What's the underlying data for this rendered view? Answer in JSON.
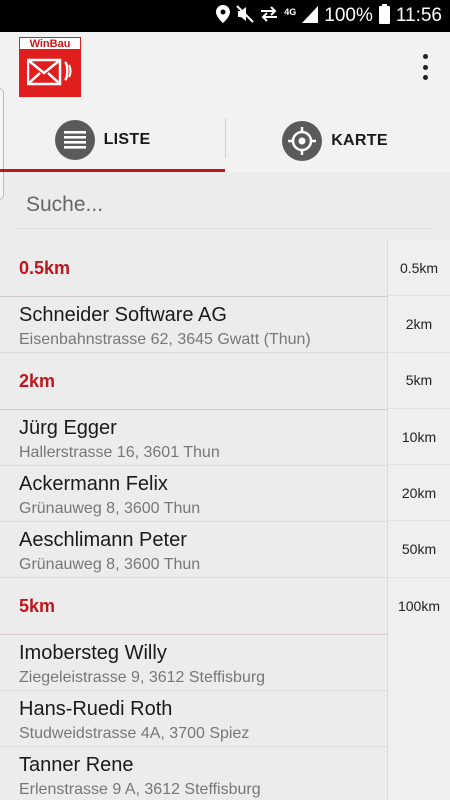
{
  "status_bar": {
    "battery": "100%",
    "time": "11:56",
    "network": "4G",
    "icons": [
      "location-icon",
      "mute-icon",
      "data-transfer-icon",
      "signal-icon",
      "battery-icon"
    ]
  },
  "app": {
    "logo_text": "WinBau",
    "menu_icon": "more-vert-icon"
  },
  "tabs": [
    {
      "label": "LISTE",
      "icon": "list-icon",
      "active": true
    },
    {
      "label": "KARTE",
      "icon": "crosshair-icon",
      "active": false
    }
  ],
  "search": {
    "placeholder": "Suche...",
    "value": ""
  },
  "list": {
    "sections": [
      {
        "label": "0.5km",
        "items": [
          {
            "name": "Schneider Software AG",
            "address": "Eisenbahnstrasse 62, 3645 Gwatt (Thun)"
          }
        ]
      },
      {
        "label": "2km",
        "items": [
          {
            "name": "Jürg Egger",
            "address": "Hallerstrasse 16, 3601 Thun"
          },
          {
            "name": "Ackermann Felix",
            "address": "Grünauweg 8, 3600 Thun"
          },
          {
            "name": "Aeschlimann Peter",
            "address": "Grünauweg 8, 3600 Thun"
          }
        ]
      },
      {
        "label": "5km",
        "items": [
          {
            "name": "Imobersteg Willy",
            "address": "Ziegeleistrasse 9, 3612 Steffisburg"
          },
          {
            "name": "Hans-Ruedi Roth",
            "address": "Studweidstrasse 4A, 3700 Spiez"
          },
          {
            "name": "Tanner Rene",
            "address": "Erlenstrasse 9 A, 3612 Steffisburg"
          }
        ]
      }
    ]
  },
  "distance_index": [
    "0.5km",
    "2km",
    "5km",
    "10km",
    "20km",
    "50km",
    "100km"
  ],
  "colors": {
    "accent": "#c2151b",
    "logo_red": "#e01e1e",
    "status_bar": "#000000",
    "background": "#ececec"
  }
}
